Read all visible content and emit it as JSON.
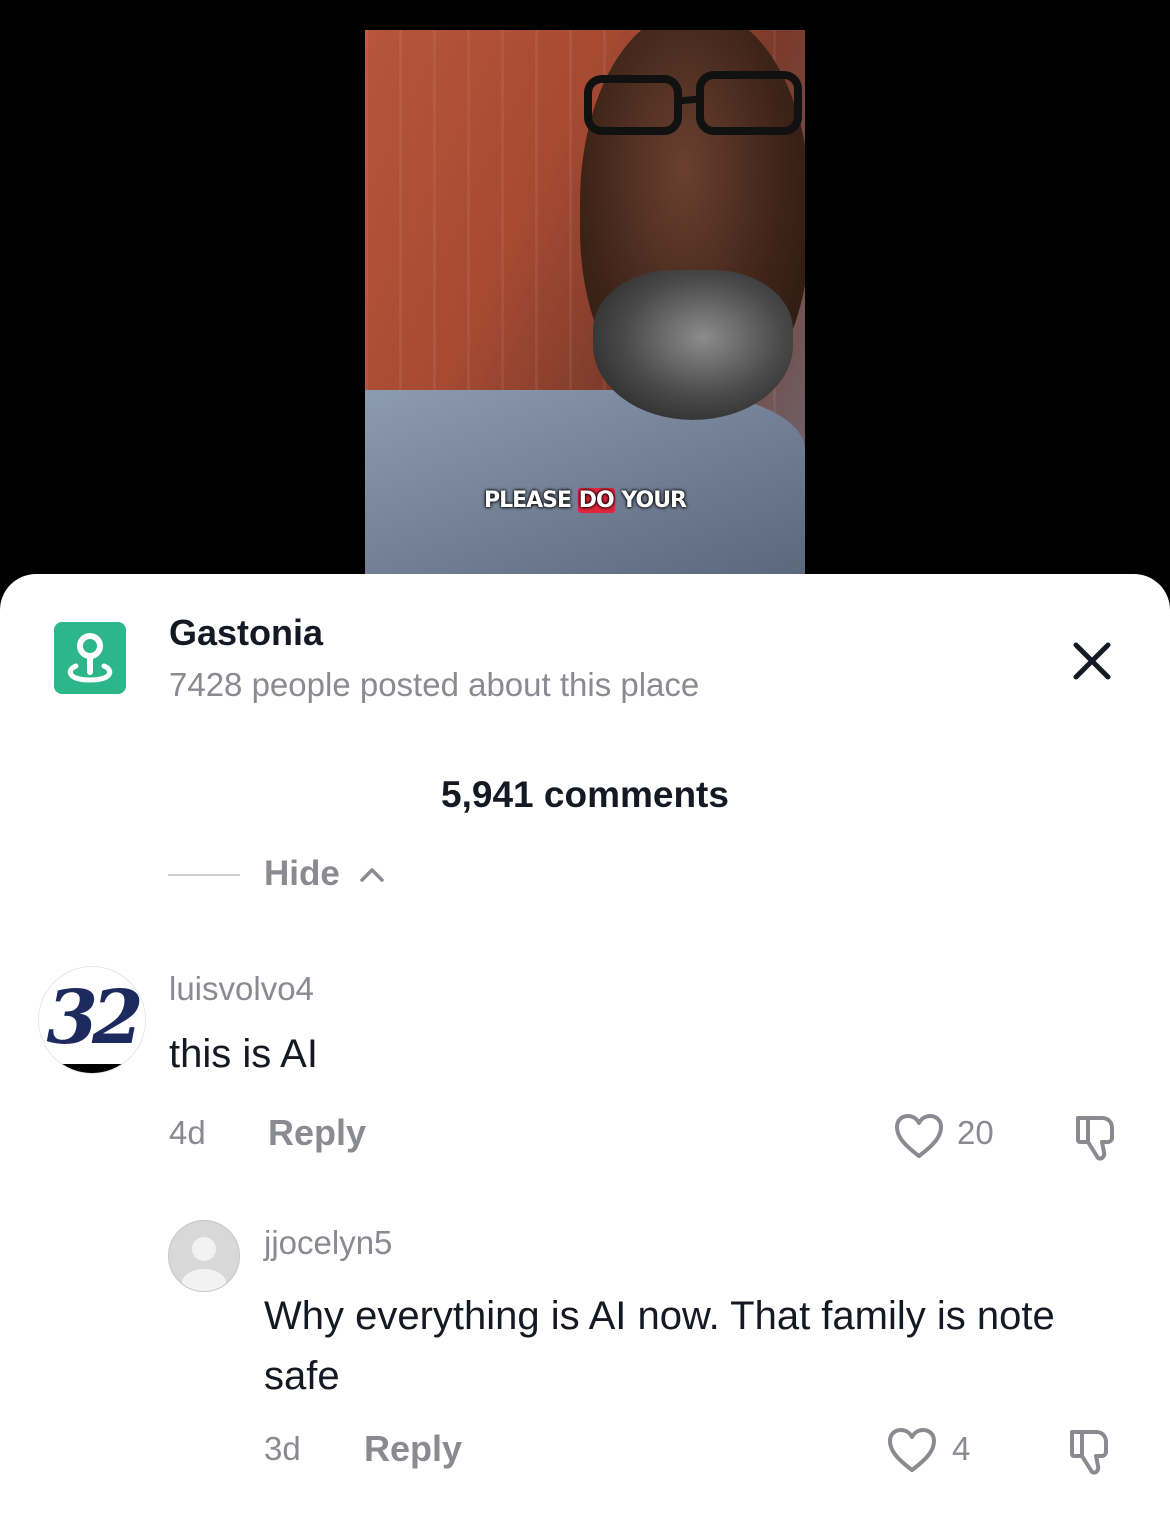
{
  "video": {
    "caption_pre": "PLEASE ",
    "caption_highlight": "DO",
    "caption_post": " YOUR"
  },
  "place": {
    "icon": "location-pin-icon",
    "title": "Gastonia",
    "subtitle": "7428 people posted about this place"
  },
  "comments_header": {
    "count_label": "5,941 comments",
    "close_icon": "close-icon"
  },
  "thread": {
    "hide_label": "Hide"
  },
  "comments": [
    {
      "avatar_text": "32",
      "username": "luisvolvo4",
      "text": "this is AI",
      "time": "4d",
      "reply_label": "Reply",
      "likes": "20"
    },
    {
      "avatar_icon": "default-avatar-icon",
      "username": "jjocelyn5",
      "text": "Why everything is AI now. That family is note safe",
      "time": "3d",
      "reply_label": "Reply",
      "likes": "4"
    }
  ],
  "colors": {
    "accent_place": "#2db68a",
    "text_primary": "#161823",
    "text_secondary": "#8a8b91",
    "caption_highlight": "#e0263a"
  }
}
